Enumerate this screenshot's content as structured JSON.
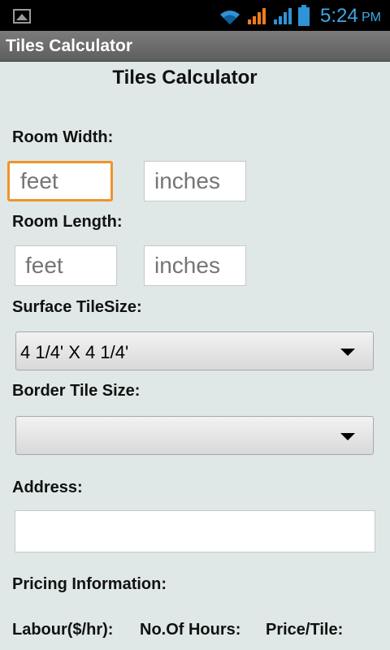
{
  "status_bar": {
    "time": "5:24",
    "ampm": "PM",
    "icons": [
      "image-icon",
      "wifi-icon",
      "signal-icon",
      "signal-icon",
      "battery-icon"
    ]
  },
  "app": {
    "title": "Tiles Calculator"
  },
  "form": {
    "heading": "Tiles Calculator",
    "room_width": {
      "label": "Room Width:",
      "feet_placeholder": "feet",
      "inches_placeholder": "inches"
    },
    "room_length": {
      "label": "Room Length:",
      "feet_placeholder": "feet",
      "inches_placeholder": "inches"
    },
    "surface_tile": {
      "label": "Surface TileSize:",
      "selected": "4 1/4' X 4 1/4'"
    },
    "border_tile": {
      "label": "Border Tile Size:",
      "selected": ""
    },
    "address": {
      "label": "Address:",
      "value": ""
    },
    "pricing": {
      "label": "Pricing Information:",
      "labour_label": "Labour($/hr):",
      "hours_label": "No.Of Hours:",
      "price_label": "Price/Tile:"
    }
  },
  "colors": {
    "accent_time": "#3da8e8",
    "focus_border": "#f0932b",
    "content_bg": "#dfe8e6"
  }
}
